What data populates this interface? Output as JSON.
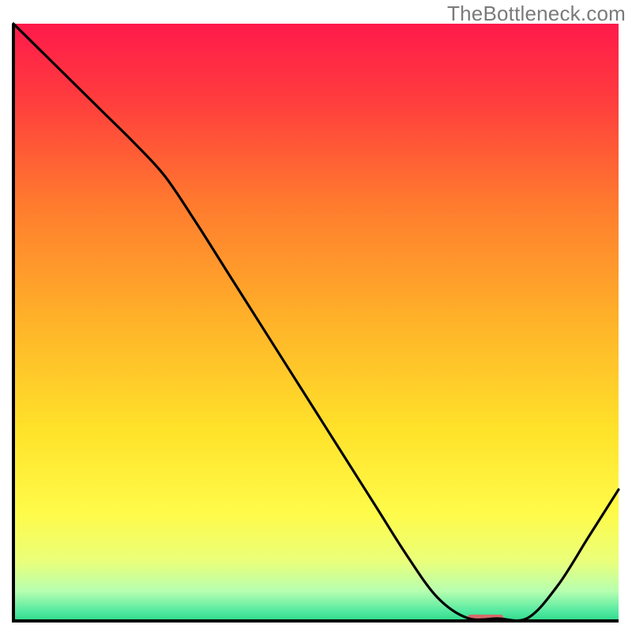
{
  "watermark": "TheBottleneck.com",
  "chart_data": {
    "type": "line",
    "title": "",
    "xlabel": "",
    "ylabel": "",
    "xlim": [
      0,
      100
    ],
    "ylim": [
      0,
      100
    ],
    "x": [
      0,
      5,
      10,
      15,
      20,
      25,
      30,
      35,
      40,
      45,
      50,
      55,
      60,
      65,
      70,
      75,
      80,
      85,
      90,
      95,
      100
    ],
    "values": [
      100,
      95,
      90,
      85,
      80,
      74.5,
      67,
      59,
      51,
      43,
      35,
      27,
      19,
      11,
      4,
      0.5,
      0.4,
      0.5,
      6,
      14,
      22
    ],
    "marker": {
      "x": 78,
      "y": 0.5,
      "w": 6,
      "h": 1.1
    },
    "grid": false,
    "legend": null
  },
  "colors": {
    "curve": "#000000",
    "axis": "#000000",
    "marker": "#d66a6a",
    "gradient_stops": [
      {
        "offset": 0.0,
        "color": "#ff1a4b"
      },
      {
        "offset": 0.12,
        "color": "#ff3a3e"
      },
      {
        "offset": 0.3,
        "color": "#ff7a2e"
      },
      {
        "offset": 0.5,
        "color": "#ffb329"
      },
      {
        "offset": 0.68,
        "color": "#ffe22a"
      },
      {
        "offset": 0.82,
        "color": "#fffb4a"
      },
      {
        "offset": 0.9,
        "color": "#eaff7a"
      },
      {
        "offset": 0.95,
        "color": "#b7ffb0"
      },
      {
        "offset": 0.985,
        "color": "#50e8a0"
      },
      {
        "offset": 1.0,
        "color": "#2fd98a"
      }
    ]
  }
}
